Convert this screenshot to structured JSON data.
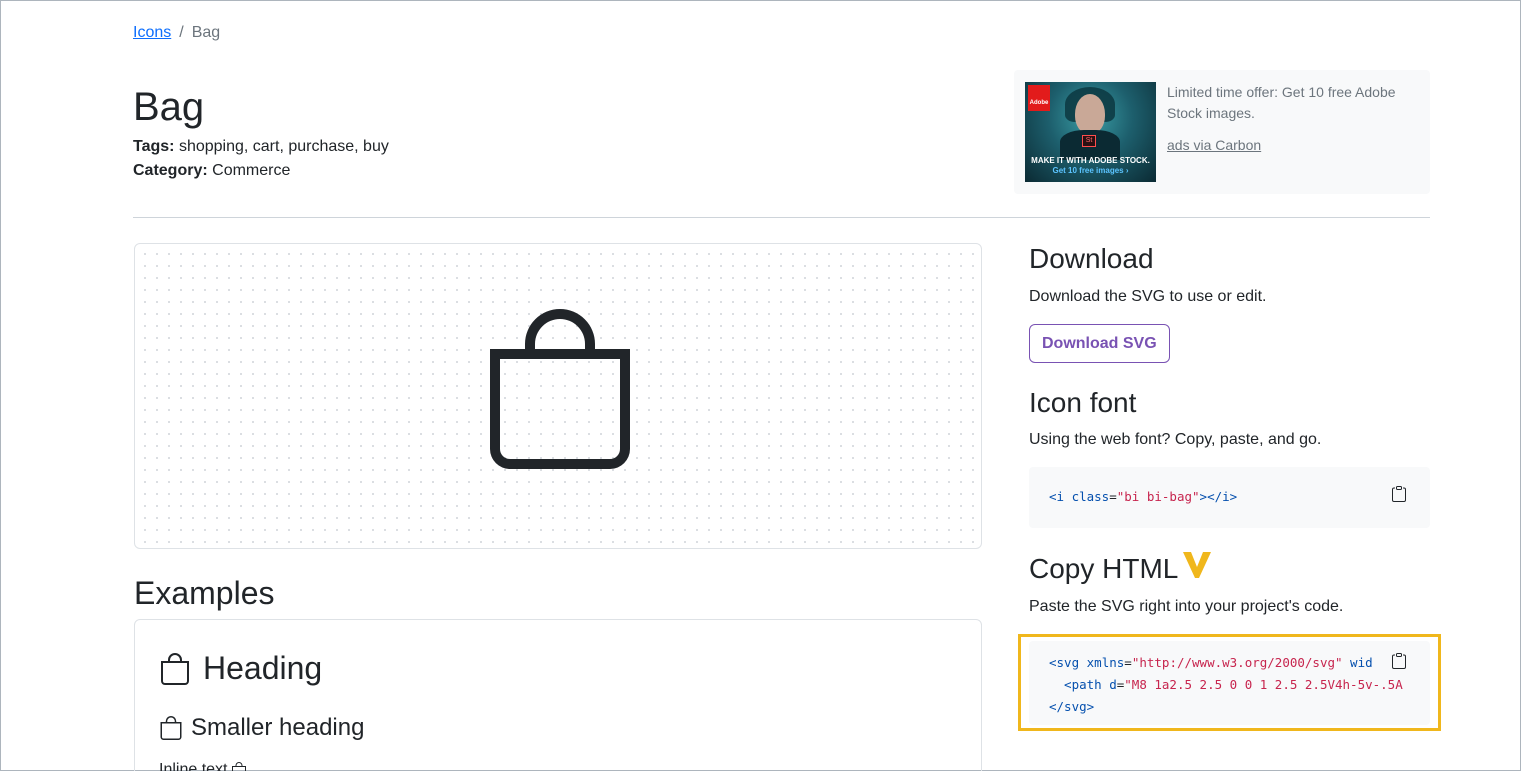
{
  "breadcrumb": {
    "link": "Icons",
    "separator": "/",
    "current": "Bag"
  },
  "header": {
    "title": "Bag",
    "tags_label": "Tags:",
    "tags": "shopping, cart, purchase, buy",
    "category_label": "Category:",
    "category": "Commerce"
  },
  "ad": {
    "logo": "Adobe",
    "badge": "St",
    "caption": "MAKE IT WITH ADOBE STOCK.",
    "caption_sub": "Get 10 free images ›",
    "text": "Limited time offer: Get 10 free Adobe Stock images.",
    "via": "ads via Carbon"
  },
  "examples": {
    "title": "Examples",
    "heading": "Heading",
    "smaller_heading": "Smaller heading",
    "inline_text": "Inline text"
  },
  "download": {
    "title": "Download",
    "description": "Download the SVG to use or edit.",
    "button": "Download SVG"
  },
  "icon_font": {
    "title": "Icon font",
    "description": "Using the web font? Copy, paste, and go.",
    "code": {
      "open": "<i ",
      "attr": "class",
      "eq": "=",
      "value": "\"bi bi-bag\"",
      "close": "></i>"
    }
  },
  "copy_html": {
    "title": "Copy HTML",
    "description": "Paste the SVG right into your project's code.",
    "line1": {
      "tag": "<svg ",
      "attr": "xmlns",
      "eq": "=",
      "value": "\"http://www.w3.org/2000/svg\"",
      "rest": " wid"
    },
    "line2": {
      "tag": "  <path ",
      "attr": "d",
      "eq": "=",
      "value": "\"M8 1a2.5 2.5 0 0 1 2.5 2.5V4h-5v-.5A"
    },
    "line3": "</svg>"
  },
  "colors": {
    "accent": "#7952b3",
    "link": "#0d6efd",
    "highlight": "#f0b71c",
    "code_string": "#c7254e",
    "code_tag": "#0550ae"
  }
}
